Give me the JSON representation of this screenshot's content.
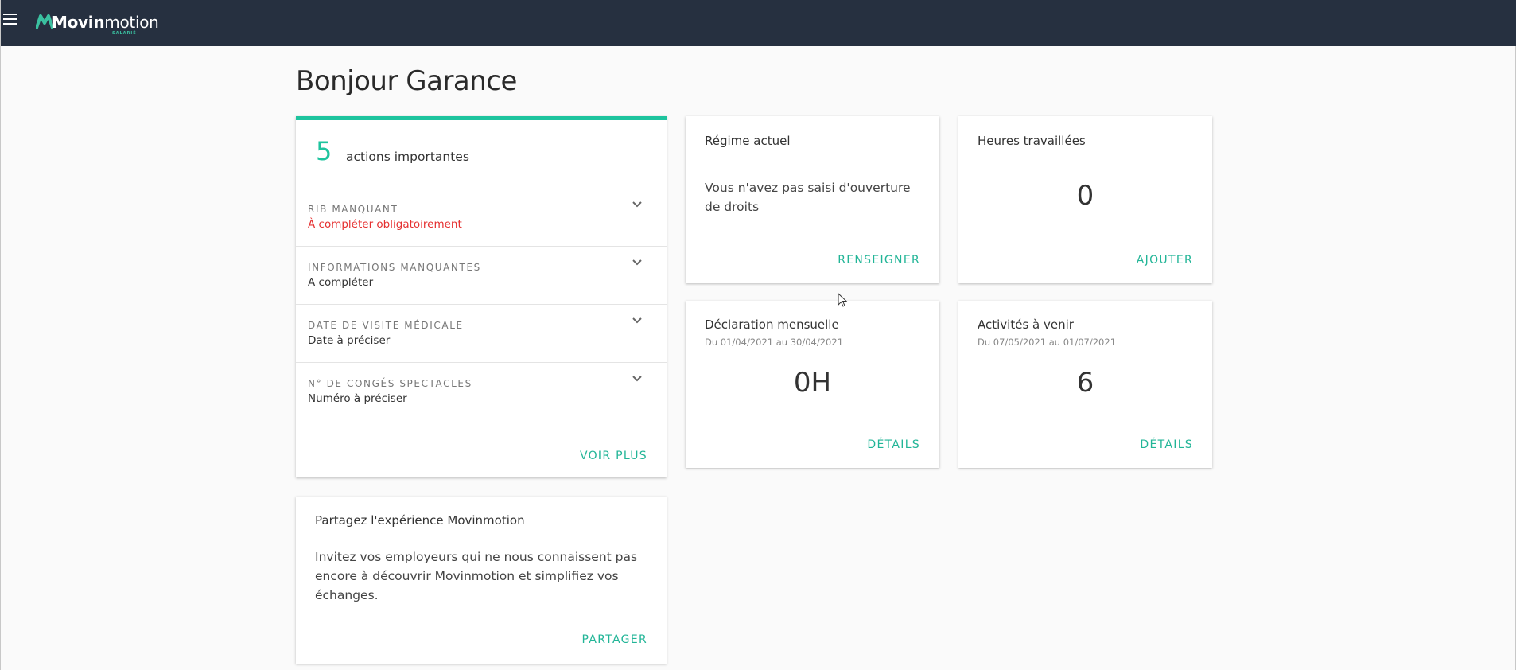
{
  "header": {
    "logo_bold": "Movin",
    "logo_thin": "motion",
    "logo_sub": "SALARIÉ"
  },
  "greeting": "Bonjour Garance",
  "actions": {
    "count": "5",
    "count_label": "actions importantes",
    "items": [
      {
        "label": "RIB MANQUANT",
        "value": "À compléter obligatoirement"
      },
      {
        "label": "INFORMATIONS MANQUANTES",
        "value": "A compléter"
      },
      {
        "label": "DATE DE VISITE MÉDICALE",
        "value": "Date à préciser"
      },
      {
        "label": "N° DE CONGÉS SPECTACLES",
        "value": "Numéro à préciser"
      }
    ],
    "more_label": "VOIR PLUS"
  },
  "regime": {
    "title": "Régime actuel",
    "body": "Vous n'avez pas saisi d'ouverture de droits",
    "action": "RENSEIGNER"
  },
  "heures": {
    "title": "Heures travaillées",
    "value": "0",
    "action": "AJOUTER"
  },
  "declaration": {
    "title": "Déclaration mensuelle",
    "period": "Du 01/04/2021 au 30/04/2021",
    "value": "0H",
    "action": "DÉTAILS"
  },
  "activites": {
    "title": "Activités à venir",
    "period": "Du 07/05/2021 au 01/07/2021",
    "value": "6",
    "action": "DÉTAILS"
  },
  "share": {
    "title": "Partagez l'expérience Movinmotion",
    "body": "Invitez vos employeurs qui ne nous connaissent pas encore à découvrir Movinmotion et simplifiez vos échanges.",
    "action": "PARTAGER"
  },
  "colors": {
    "topbar": "#263040",
    "accent": "#1ec49e",
    "error": "#e53030"
  }
}
